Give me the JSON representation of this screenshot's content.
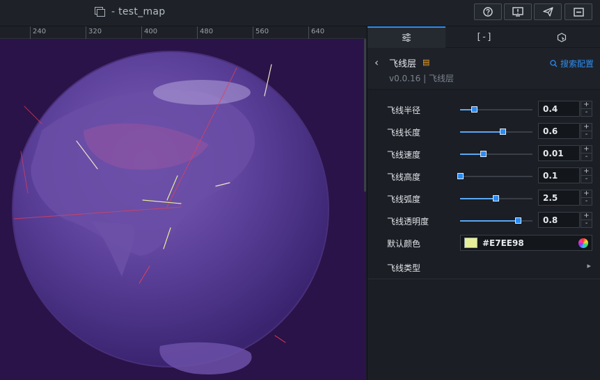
{
  "topbar": {
    "title": "- test_map",
    "buttons": [
      {
        "name": "help-button",
        "icon": "help-icon"
      },
      {
        "name": "preview-button",
        "icon": "alert-screen-icon"
      },
      {
        "name": "publish-button",
        "icon": "send-icon"
      },
      {
        "name": "minimize-button",
        "icon": "minus-box-icon"
      }
    ]
  },
  "ruler": {
    "labels": [
      "240",
      "320",
      "400",
      "480",
      "560",
      "640"
    ]
  },
  "panel": {
    "tabs": [
      {
        "name": "tab-style",
        "icon": "sliders-icon",
        "glyph": "≡"
      },
      {
        "name": "tab-data",
        "icon": "bracket-icon",
        "glyph": "[-]"
      },
      {
        "name": "tab-interaction",
        "icon": "cursor-hex-icon",
        "glyph": "⬡"
      }
    ],
    "layer": {
      "name": "飞线层",
      "version": "v0.0.16 | 飞线层",
      "search_label": "搜索配置"
    },
    "props": [
      {
        "label": "飞线半径",
        "value": "0.4",
        "fraction": 0.19
      },
      {
        "label": "飞线长度",
        "value": "0.6",
        "fraction": 0.59
      },
      {
        "label": "飞线速度",
        "value": "0.01",
        "fraction": 0.32
      },
      {
        "label": "飞线高度",
        "value": "0.1",
        "fraction": 0.0
      },
      {
        "label": "飞线弧度",
        "value": "2.5",
        "fraction": 0.49
      },
      {
        "label": "飞线透明度",
        "value": "0.8",
        "fraction": 0.8
      }
    ],
    "color": {
      "label": "默认颜色",
      "value": "#E7EE98"
    },
    "type": {
      "label": "飞线类型"
    }
  },
  "colors": {
    "accent": "#2d8cf0",
    "canvas_bg": "#2a1348",
    "globe": "#5b3f9a",
    "swatch": "#E7EE98"
  }
}
